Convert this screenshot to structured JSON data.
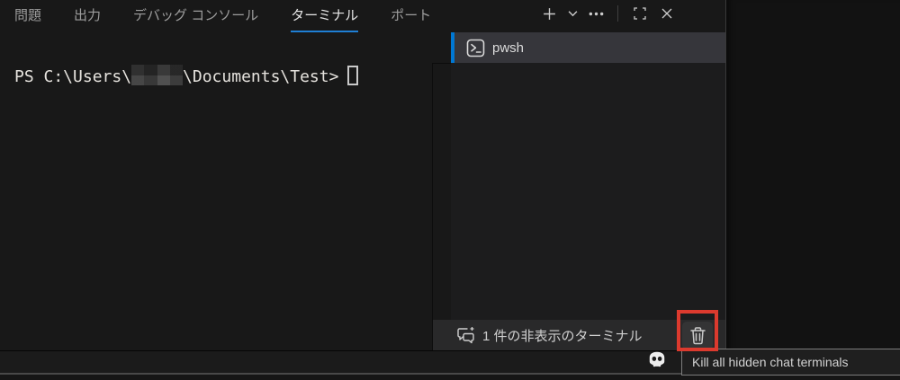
{
  "panel": {
    "tabs": [
      {
        "label": "問題",
        "active": false
      },
      {
        "label": "出力",
        "active": false
      },
      {
        "label": "デバッグ コンソール",
        "active": false
      },
      {
        "label": "ターミナル",
        "active": true
      },
      {
        "label": "ポート",
        "active": false
      }
    ],
    "toolbar_icons": [
      "plus-icon",
      "chevron-down-icon",
      "ellipsis-icon",
      "screen-full-icon",
      "close-icon"
    ]
  },
  "terminal": {
    "prompt_prefix": "PS C:\\Users\\",
    "prompt_suffix": "\\Documents\\Test>",
    "cursor": "hollow-block"
  },
  "terminal_list": {
    "items": [
      {
        "label": "pwsh",
        "icon": "terminal-icon",
        "selected": true
      }
    ],
    "hidden_row": {
      "icon": "chat-sparkle-icon",
      "label": "1 件の非表示のターミナル",
      "action_icon": "trash-icon"
    }
  },
  "status_strip": {
    "copilot_icon": "copilot-icon"
  },
  "tooltip": {
    "text": "Kill all hidden chat terminals"
  },
  "annotation": {
    "shape": "red-rectangle",
    "color": "#dc3a2e",
    "target": "trash-icon"
  },
  "colors": {
    "accent_blue": "#0078d4",
    "tab_underline": "#1f7fd4",
    "selection_bg": "#36363b",
    "panel_bg": "#181818",
    "annotation_red": "#dc3a2e"
  }
}
